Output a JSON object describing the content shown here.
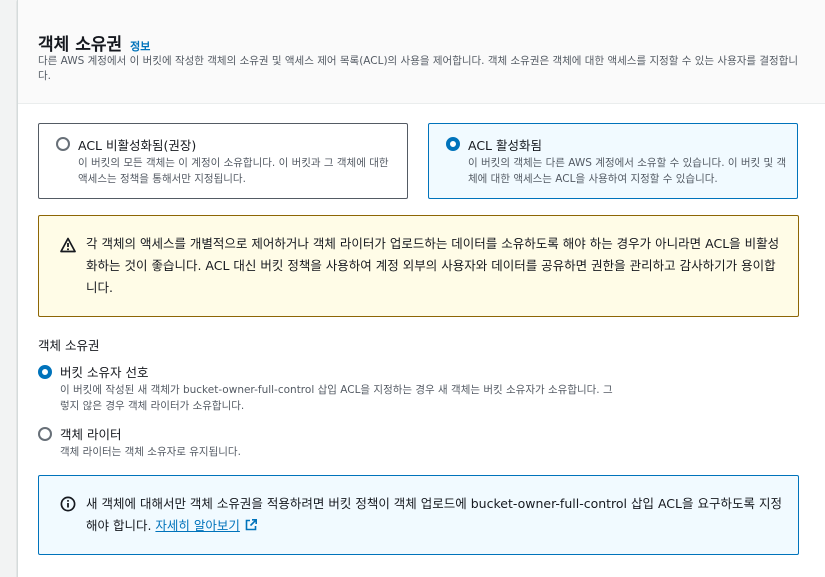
{
  "header": {
    "title": "객체 소유권",
    "info_link": "정보",
    "description": "다른 AWS 계정에서 이 버킷에 작성한 객체의 소유권 및 액세스 제어 목록(ACL)의 사용을 제어합니다. 객체 소유권은 객체에 대한 액세스를 지정할 수 있는 사용자를 결정합니다."
  },
  "acl_tiles": [
    {
      "label": "ACL 비활성화됨(권장)",
      "description": "이 버킷의 모든 객체는 이 계정이 소유합니다. 이 버킷과 그 객체에 대한 액세스는 정책을 통해서만 지정됩니다.",
      "selected": false
    },
    {
      "label": "ACL 활성화됨",
      "description": "이 버킷의 객체는 다른 AWS 계정에서 소유할 수 있습니다. 이 버킷 및 객체에 대한 액세스는 ACL을 사용하여 지정할 수 있습니다.",
      "selected": true
    }
  ],
  "warning": {
    "icon": "warning-icon",
    "text": "각 객체의 액세스를 개별적으로 제어하거나 객체 라이터가 업로드하는 데이터를 소유하도록 해야 하는 경우가 아니라면 ACL을 비활성화하는 것이 좋습니다. ACL 대신 버킷 정책을 사용하여 계정 외부의 사용자와 데이터를 공유하면 권한을 관리하고 감사하기가 용이합니다."
  },
  "ownership": {
    "label": "객체 소유권",
    "options": [
      {
        "label": "버킷 소유자 선호",
        "description": "이 버킷에 작성된 새 객체가 bucket-owner-full-control 삽입 ACL을 지정하는 경우 새 객체는 버킷 소유자가 소유합니다. 그렇지 않은 경우 객체 라이터가 소유합니다.",
        "selected": true
      },
      {
        "label": "객체 라이터",
        "description": "객체 라이터는 객체 소유자로 유지됩니다.",
        "selected": false
      }
    ]
  },
  "info": {
    "icon": "info-icon",
    "text": "새 객체에 대해서만 객체 소유권을 적용하려면 버킷 정책이 객체 업로드에 bucket-owner-full-control 삽입 ACL을 요구하도록 지정해야 합니다. ",
    "link": "자세히 알아보기"
  },
  "colors": {
    "accent": "#0073bb",
    "warning_border": "#8d6605",
    "warning_bg": "#fffce7",
    "info_bg": "#f1faff"
  }
}
